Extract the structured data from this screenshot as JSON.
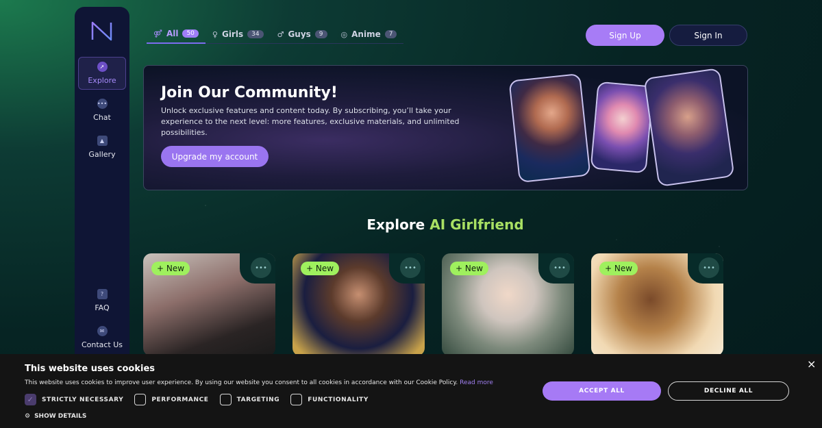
{
  "sidebar": {
    "items": [
      {
        "label": "Explore",
        "icon": "compass-icon"
      },
      {
        "label": "Chat",
        "icon": "chat-icon"
      },
      {
        "label": "Gallery",
        "icon": "image-icon"
      },
      {
        "label": "FAQ",
        "icon": "question-icon"
      },
      {
        "label": "Contact Us",
        "icon": "mail-icon"
      }
    ]
  },
  "tabs": [
    {
      "label": "All",
      "count": "50",
      "icon": "couple-icon",
      "glyph": "⚤"
    },
    {
      "label": "Girls",
      "count": "34",
      "icon": "female-icon",
      "glyph": "♀"
    },
    {
      "label": "Guys",
      "count": "9",
      "icon": "male-icon",
      "glyph": "♂"
    },
    {
      "label": "Anime",
      "count": "7",
      "icon": "anime-icon",
      "glyph": "◎"
    }
  ],
  "header": {
    "signup_label": "Sign Up",
    "signin_label": "Sign In"
  },
  "banner": {
    "title": "Join Our Community!",
    "text": "Unlock exclusive features and content today. By subscribing, you’ll take your experience to the next level: more features, exclusive materials, and unlimited possibilities.",
    "button": "Upgrade my account"
  },
  "section": {
    "title_prefix": "Explore ",
    "title_highlight": "AI Girlfriend"
  },
  "cards": [
    {
      "badge": "+ New"
    },
    {
      "badge": "+ New"
    },
    {
      "badge": "+ New"
    },
    {
      "badge": "+ New"
    }
  ],
  "cookie": {
    "title": "This website uses cookies",
    "description": "This website uses cookies to improve user experience. By using our website you consent to all cookies in accordance with our Cookie Policy.",
    "read_more": "Read more",
    "checks": [
      {
        "label": "STRICTLY NECESSARY",
        "checked": true
      },
      {
        "label": "PERFORMANCE",
        "checked": false
      },
      {
        "label": "TARGETING",
        "checked": false
      },
      {
        "label": "FUNCTIONALITY",
        "checked": false
      }
    ],
    "show_details": "SHOW DETAILS",
    "accept": "ACCEPT ALL",
    "decline": "DECLINE ALL",
    "close": "×"
  },
  "colors": {
    "accent": "#a77cf6",
    "highlight": "#a8e063",
    "new_badge": "#9ff05e"
  }
}
